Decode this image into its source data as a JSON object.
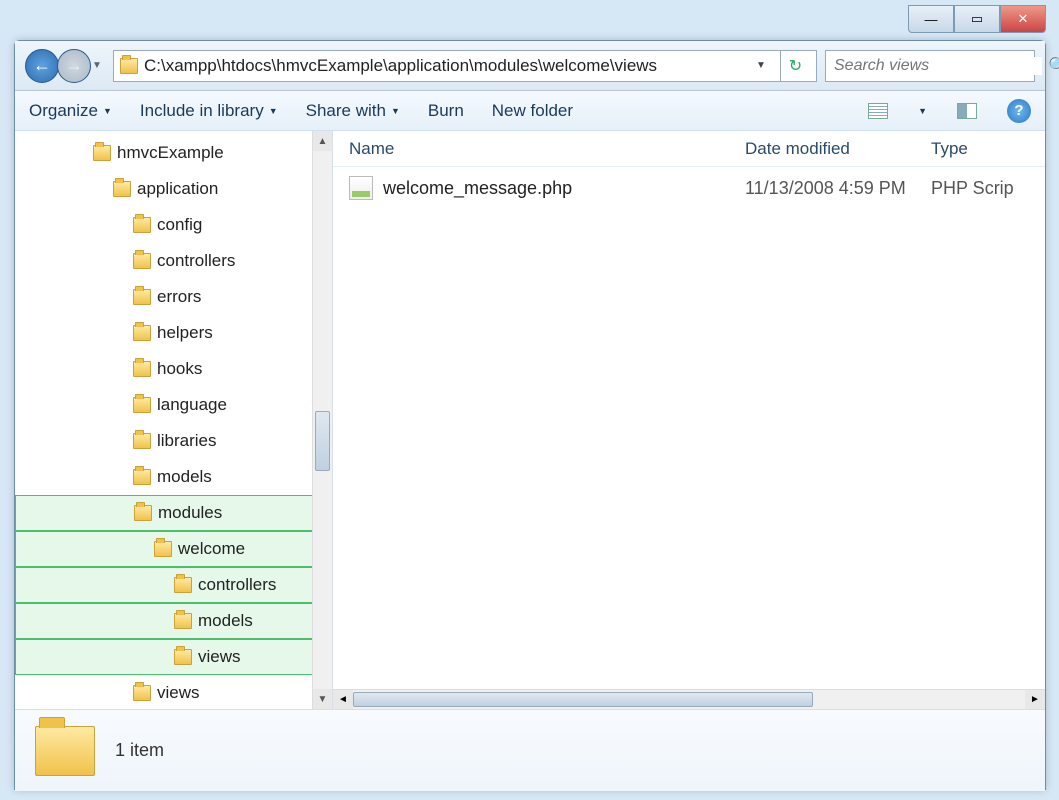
{
  "address_path": "C:\\xampp\\htdocs\\hmvcExample\\application\\modules\\welcome\\views",
  "search_placeholder": "Search views",
  "toolbar": {
    "organize": "Organize",
    "include": "Include in library",
    "share": "Share with",
    "burn": "Burn",
    "newfolder": "New folder"
  },
  "columns": {
    "name": "Name",
    "date": "Date modified",
    "type": "Type"
  },
  "files": [
    {
      "name": "welcome_message.php",
      "date": "11/13/2008 4:59 PM",
      "type": "PHP Scrip"
    }
  ],
  "tree": [
    {
      "label": "hmvcExample",
      "indent": 72
    },
    {
      "label": "application",
      "indent": 92
    },
    {
      "label": "config",
      "indent": 112
    },
    {
      "label": "controllers",
      "indent": 112
    },
    {
      "label": "errors",
      "indent": 112
    },
    {
      "label": "helpers",
      "indent": 112
    },
    {
      "label": "hooks",
      "indent": 112
    },
    {
      "label": "language",
      "indent": 112
    },
    {
      "label": "libraries",
      "indent": 112
    },
    {
      "label": "models",
      "indent": 112
    },
    {
      "label": "modules",
      "indent": 112,
      "hl": true
    },
    {
      "label": "welcome",
      "indent": 132,
      "hl": true
    },
    {
      "label": "controllers",
      "indent": 152,
      "hl": true
    },
    {
      "label": "models",
      "indent": 152,
      "hl": true
    },
    {
      "label": "views",
      "indent": 152,
      "hl": true
    },
    {
      "label": "views",
      "indent": 112
    }
  ],
  "status": "1 item"
}
